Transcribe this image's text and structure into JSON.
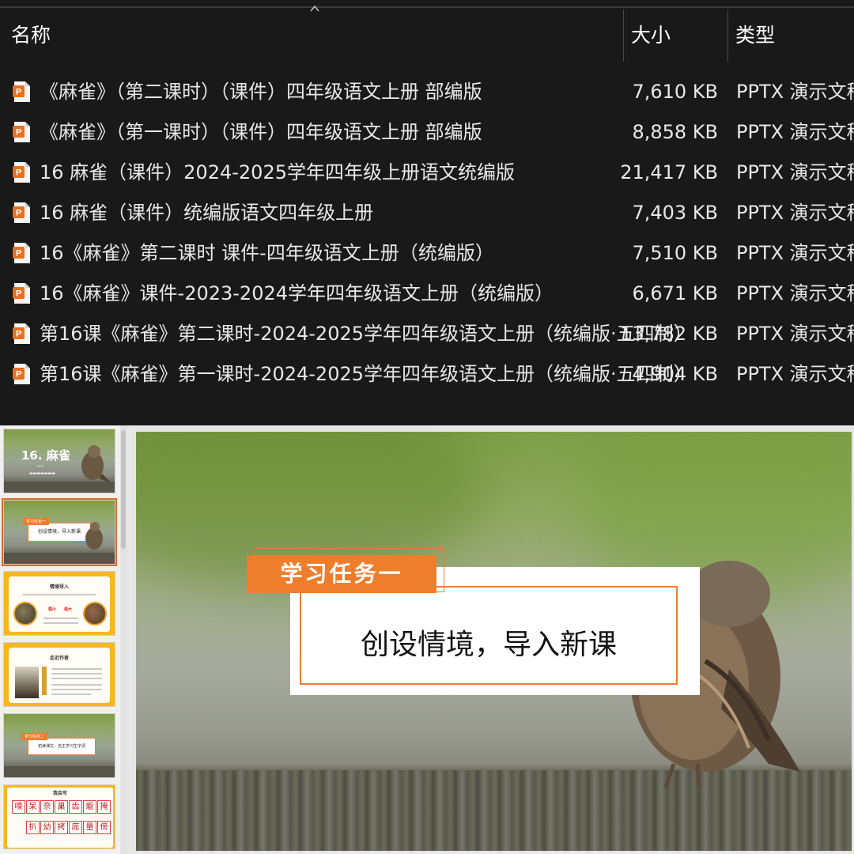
{
  "explorer": {
    "columns": {
      "name": "名称",
      "size": "大小",
      "type": "类型"
    },
    "files": [
      {
        "name": "《麻雀》（第二课时）（课件）四年级语文上册 部编版",
        "size": "7,610 KB",
        "type": "PPTX 演示文稿"
      },
      {
        "name": "《麻雀》（第一课时）（课件）四年级语文上册 部编版",
        "size": "8,858 KB",
        "type": "PPTX 演示文稿"
      },
      {
        "name": "16 麻雀（课件）2024-2025学年四年级上册语文统编版",
        "size": "21,417 KB",
        "type": "PPTX 演示文稿"
      },
      {
        "name": "16 麻雀（课件）统编版语文四年级上册",
        "size": "7,403 KB",
        "type": "PPTX 演示文稿"
      },
      {
        "name": "16《麻雀》第二课时 课件-四年级语文上册（统编版）",
        "size": "7,510 KB",
        "type": "PPTX 演示文稿"
      },
      {
        "name": "16《麻雀》课件-2023-2024学年四年级语文上册（统编版）",
        "size": "6,671 KB",
        "type": "PPTX 演示文稿"
      },
      {
        "name": "第16课《麻雀》第二课时-2024-2025学年四年级语文上册（统编版·五四制）",
        "size": "13,782 KB",
        "type": "PPTX 演示文稿"
      },
      {
        "name": "第16课《麻雀》第一课时-2024-2025学年四年级语文上册（统编版·五四制）",
        "size": "4,904 KB",
        "type": "PPTX 演示文稿"
      }
    ],
    "file_icon": "powerpoint-file-icon",
    "accent_color": "#e8701e"
  },
  "thumbnails": {
    "t1": {
      "title": "16. 麻雀"
    },
    "t2": {
      "tag": "学习任务一",
      "text": "创设情境，导入新课"
    },
    "t3": {
      "title": "情境导入",
      "weak": "弱小",
      "strong": "强大"
    },
    "t4": {
      "title": "走近作者"
    },
    "t5": {
      "tag": "学习任务二",
      "text": "初读课文，自主学习生字词"
    },
    "t6": {
      "title": "我会写",
      "chars": [
        "嗅",
        "呆",
        "奈",
        "巢",
        "齿",
        "躯",
        "掩",
        "扒",
        "幼",
        "拷",
        "庞",
        "量",
        "傍"
      ]
    }
  },
  "slide": {
    "tag": "学习任务一",
    "text": "创设情境，导入新课",
    "accent_color": "#ee7d2c"
  }
}
